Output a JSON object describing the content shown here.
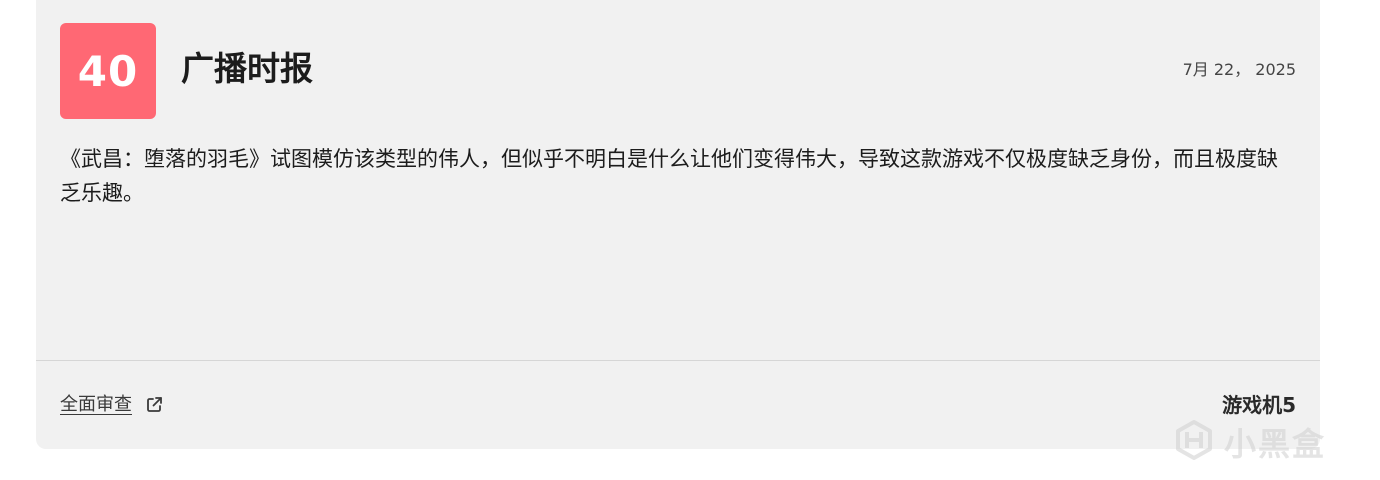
{
  "review": {
    "score": "40",
    "score_color": "#ff6874",
    "outlet": "广播时报",
    "date": "7月 22， 2025",
    "quote": "《武昌：堕落的羽毛》试图模仿该类型的伟人，但似乎不明白是什么让他们变得伟大，导致这款游戏不仅极度缺乏身份，而且极度缺乏乐趣。",
    "full_review_label": "全面审查",
    "full_review_icon": "external-link-icon",
    "platform": "游戏机5"
  },
  "watermark": {
    "text": "小黑盒",
    "icon": "heybox-logo-icon"
  }
}
